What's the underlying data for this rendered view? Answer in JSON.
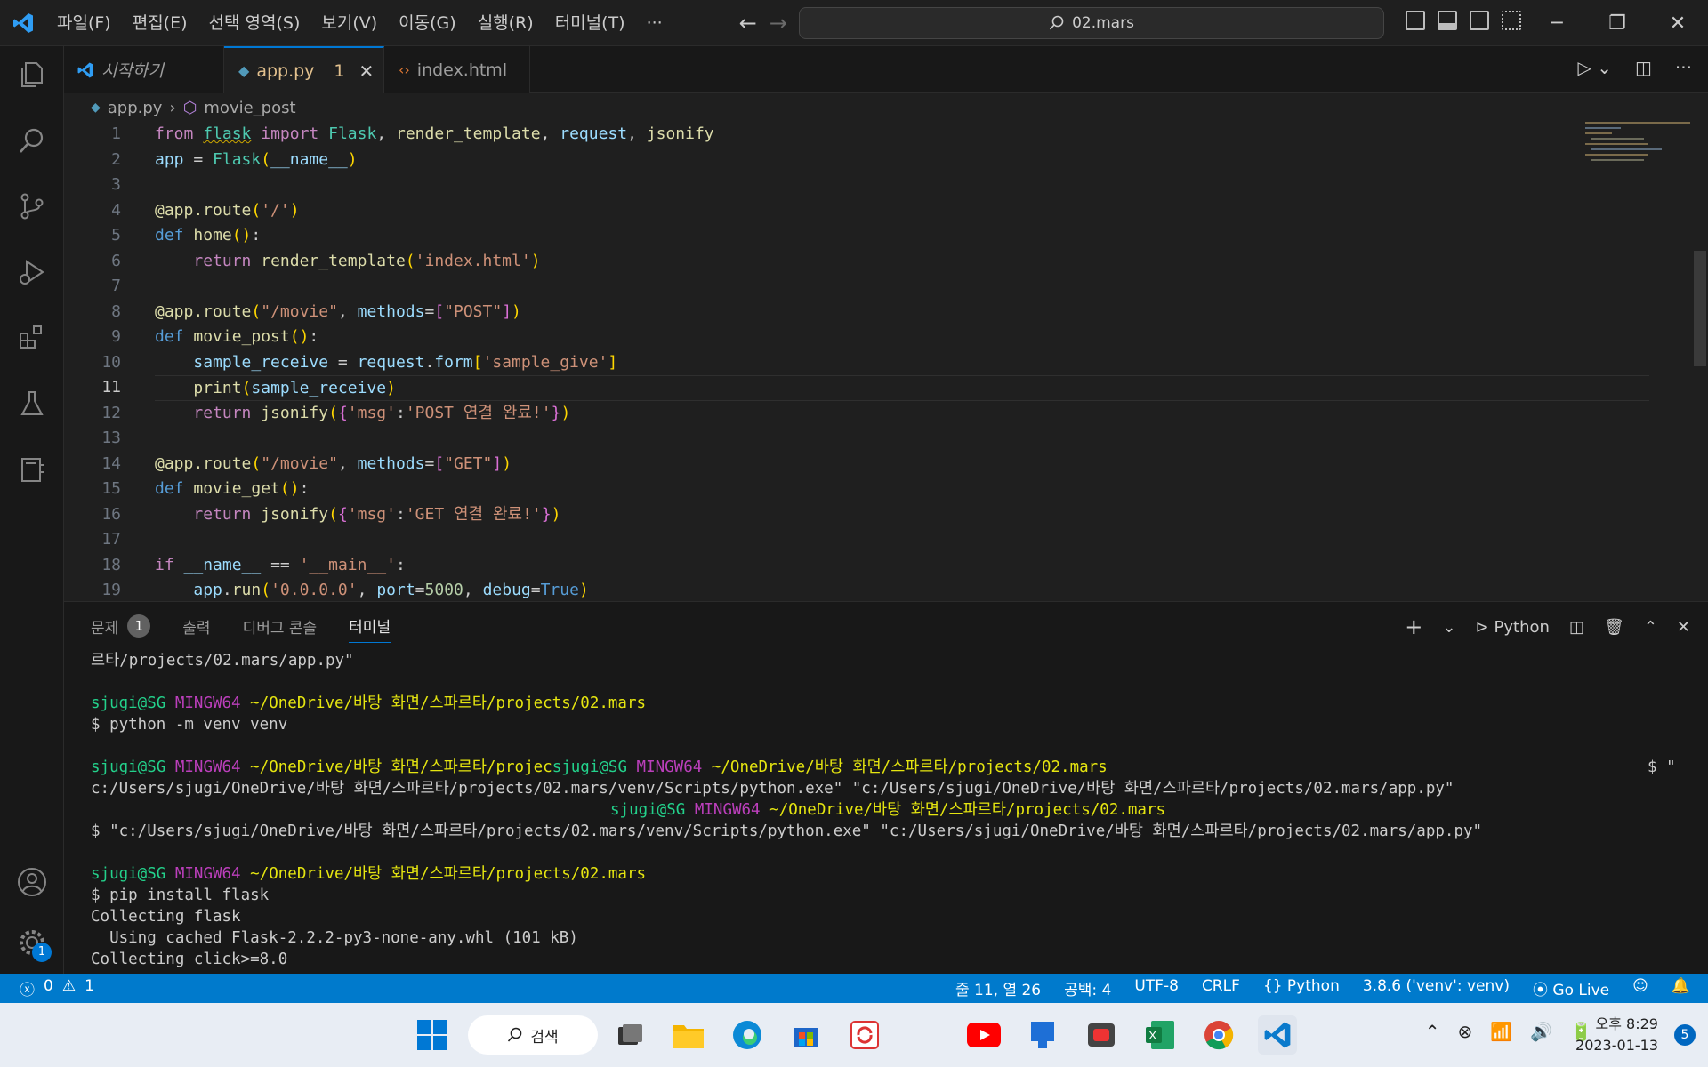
{
  "titlebar": {
    "menu": [
      "파일(F)",
      "편집(E)",
      "선택 영역(S)",
      "보기(V)",
      "이동(G)",
      "실행(R)",
      "터미널(T)",
      "···"
    ],
    "search": "02.mars"
  },
  "tabs": [
    {
      "label": "시작하기"
    },
    {
      "label": "app.py",
      "badge": "1"
    },
    {
      "label": "index.html"
    }
  ],
  "breadcrumb": {
    "file": "app.py",
    "symbol": "movie_post"
  },
  "editor": {
    "line_numbers": [
      "1",
      "2",
      "3",
      "4",
      "5",
      "6",
      "7",
      "8",
      "9",
      "10",
      "11",
      "12",
      "13",
      "14",
      "15",
      "16",
      "17",
      "18",
      "19"
    ],
    "current_line": 11
  },
  "panel": {
    "tabs": [
      {
        "label": "문제",
        "count": "1"
      },
      {
        "label": "출력"
      },
      {
        "label": "디버그 콘솔"
      },
      {
        "label": "터미널"
      }
    ],
    "shell": "Python",
    "terminal": {
      "l1": "르타/projects/02.mars/app.py\"",
      "user": "sjugi@SG",
      "host": "MINGW64",
      "path": "~/OneDrive/바탕 화면/스파르타/projects/02.mars",
      "path_partial": "~/OneDrive/바탕 화면/스파르타/projec",
      "cmd1": "$ python -m venv venv",
      "right_dollar": "$ \"",
      "l6": "c:/Users/sjugi/OneDrive/바탕 화면/스파르타/projects/02.mars/venv/Scripts/python.exe\" \"c:/Users/sjugi/OneDrive/바탕 화면/스파르타/projects/02.mars/app.py\"",
      "l8": "$ \"c:/Users/sjugi/OneDrive/바탕 화면/스파르타/projects/02.mars/venv/Scripts/python.exe\" \"c:/Users/sjugi/OneDrive/바탕 화면/스파르타/projects/02.mars/app.py\"",
      "cmd2": "$ pip install flask",
      "l11": "Collecting flask",
      "l12": "  Using cached Flask-2.2.2-py3-none-any.whl (101 kB)",
      "l13": "Collecting click>=8.0"
    }
  },
  "statusbar": {
    "errors": "0",
    "warnings": "1",
    "position": "줄 11, 열 26",
    "spaces": "공백: 4",
    "encoding": "UTF-8",
    "eol": "CRLF",
    "language": "Python",
    "interpreter": "3.8.6 ('venv': venv)",
    "golive": "Go Live"
  },
  "activity": {
    "settings_badge": "1"
  },
  "taskbar": {
    "search": "검색",
    "time": "오후 8:29",
    "date": "2023-01-13",
    "notifications": "5"
  },
  "colors": {
    "accent": "#007acc",
    "tab_active_text": "#e2c08d",
    "terminal_green": "#23d18b",
    "terminal_magenta": "#bc3fbc",
    "terminal_yellow": "#e5e510"
  }
}
